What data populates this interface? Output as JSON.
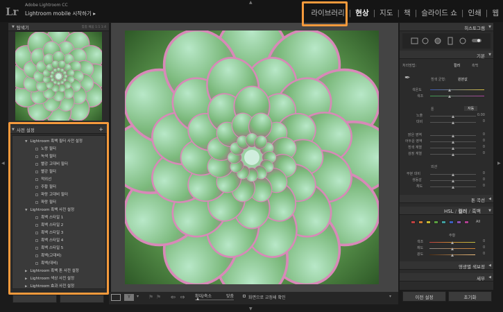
{
  "app": {
    "logo": "Lr",
    "brand": "Adobe Lightroom CC",
    "mobile_label": "Lightroom mobile 시작하기 ▸"
  },
  "modules": [
    {
      "label": "라이브러리",
      "active": false
    },
    {
      "label": "현상",
      "active": true
    },
    {
      "label": "지도",
      "active": false
    },
    {
      "label": "책",
      "active": false
    },
    {
      "label": "슬라이드 쇼",
      "active": false
    },
    {
      "label": "인쇄",
      "active": false
    },
    {
      "label": "웹",
      "active": false
    }
  ],
  "navigator": {
    "title": "탐색기",
    "options": "맞춤  채움  1:1  1:4"
  },
  "presets": {
    "title": "사전 설정",
    "add": "+",
    "groups": [
      {
        "label": "Lightroom 흑백 필터 사전 설정",
        "expanded": true,
        "items": [
          "노랑 필터",
          "녹색 필터",
          "빨강 고대비 필터",
          "빨강 필터",
          "적외선",
          "주황 필터",
          "파랑 고대비 필터",
          "파랑 필터"
        ]
      },
      {
        "label": "Lightroom 흑백 사전 설정",
        "expanded": true,
        "items": [
          "흑백 스타일 1",
          "흑백 스타일 2",
          "흑백 스타일 3",
          "흑백 스타일 4",
          "흑백 스타일 5",
          "흑백(고대비)",
          "흑백(대비)"
        ]
      },
      {
        "label": "Lightroom 흑백 톤 사전 설정",
        "expanded": false,
        "items": []
      },
      {
        "label": "Lightroom 색상 사전 설정",
        "expanded": false,
        "items": []
      },
      {
        "label": "Lightroom 효과 사전 설정",
        "expanded": false,
        "items": []
      }
    ]
  },
  "toolbar": {
    "zoom_label": "확대/축소",
    "fit_label": "맞춤",
    "soft_proof": "화면으로 교정쇄 확인"
  },
  "right": {
    "histogram_title": "히스토그램",
    "basic_title": "기본",
    "treatment_label": "처리방법:",
    "color_label": "컬러",
    "bw_label": "흑백",
    "wb_label": "흰색 균형:",
    "wb_value": "원본값",
    "temp_label": "색온도",
    "tint_label": "색조",
    "tone_label": "톤",
    "auto_label": "자동",
    "tone_rows": [
      {
        "label": "노출",
        "value": "0.00"
      },
      {
        "label": "대비",
        "value": "0"
      }
    ],
    "light_rows": [
      {
        "label": "밝은 영역",
        "value": "0"
      },
      {
        "label": "어두운 영역",
        "value": "0"
      },
      {
        "label": "흰색 계열",
        "value": "0"
      },
      {
        "label": "검정 계열",
        "value": "0"
      }
    ],
    "presence_label": "외관",
    "presence_rows": [
      {
        "label": "부분 대비",
        "value": "0"
      },
      {
        "label": "생동감",
        "value": "0"
      },
      {
        "label": "채도",
        "value": "0"
      }
    ],
    "tonecurve_title": "톤 곡선",
    "hsl_title": "HSL",
    "hsl_color": "컬러",
    "hsl_bw": "흑백",
    "hsl_all": "All",
    "hsl_sub": "주황",
    "hsl_rows": [
      {
        "label": "색조",
        "value": "0"
      },
      {
        "label": "채도",
        "value": "0"
      },
      {
        "label": "광도",
        "value": "0"
      }
    ],
    "split_title": "영광별 색보정",
    "detail_title": "세부",
    "prev_button": "이전 설정",
    "reset_button": "초기화",
    "swatch_colors": [
      "#c04040",
      "#d07a30",
      "#c8b830",
      "#5aa040",
      "#40a0a0",
      "#3a60c0",
      "#8a50b0",
      "#b04090"
    ]
  }
}
